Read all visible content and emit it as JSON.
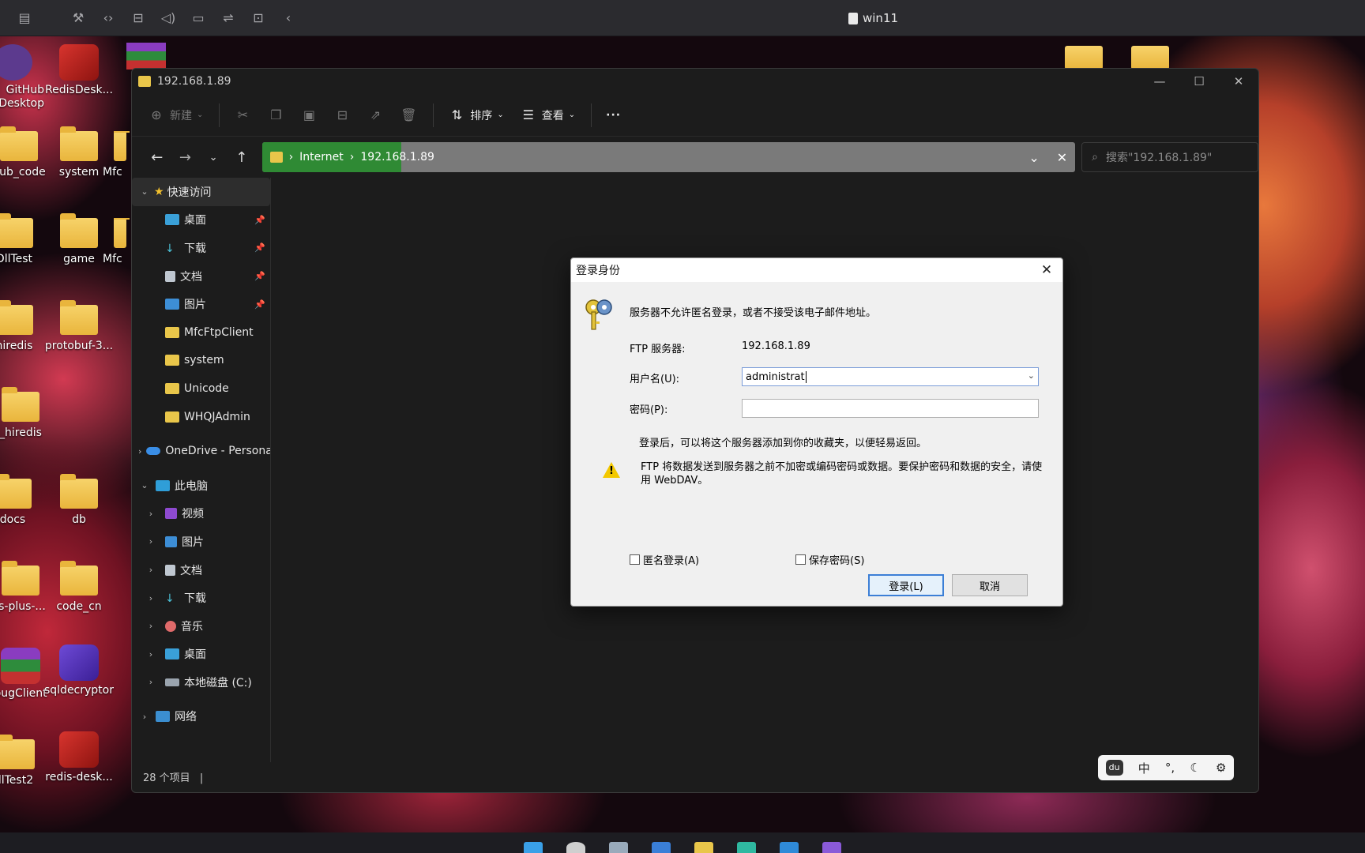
{
  "vm": {
    "title": "win11"
  },
  "desktop_icons": [
    {
      "label": "GitHub\nDesktop",
      "kind": "github"
    },
    {
      "label": "RedisDesk...",
      "kind": "redis"
    },
    {
      "label": "hub_code",
      "kind": "folder"
    },
    {
      "label": "system",
      "kind": "folder"
    },
    {
      "label": "Mfc",
      "kind": "folder"
    },
    {
      "label": "DllTest",
      "kind": "folder"
    },
    {
      "label": "game",
      "kind": "folder"
    },
    {
      "label": "Mfc",
      "kind": "folder"
    },
    {
      "label": "hiredis",
      "kind": "folder"
    },
    {
      "label": "protobuf-3...",
      "kind": "folder"
    },
    {
      "label": "_hiredis",
      "kind": "folder"
    },
    {
      "label": "docs",
      "kind": "folder"
    },
    {
      "label": "db",
      "kind": "folder"
    },
    {
      "label": "is-plus-...",
      "kind": "folder"
    },
    {
      "label": "code_cn",
      "kind": "folder"
    },
    {
      "label": "bugClient",
      "kind": "winrar"
    },
    {
      "label": "sqldecryptor",
      "kind": "sqldec"
    },
    {
      "label": "llTest2",
      "kind": "folder"
    },
    {
      "label": "redis-desk...",
      "kind": "redis"
    }
  ],
  "explorer": {
    "title": "192.168.1.89",
    "toolbar": {
      "new_label": "新建",
      "sort_label": "排序",
      "view_label": "查看",
      "more_label": "···"
    },
    "address": {
      "crumbs": [
        "Internet",
        "192.168.1.89"
      ],
      "search_placeholder": "搜索\"192.168.1.89\""
    },
    "sidebar": {
      "quick_access": "快速访问",
      "quick_items": [
        "桌面",
        "下载",
        "文档",
        "图片",
        "MfcFtpClient",
        "system",
        "Unicode",
        "WHQJAdmin"
      ],
      "onedrive": "OneDrive - Personal",
      "this_pc": "此电脑",
      "pc_items": [
        "视频",
        "图片",
        "文档",
        "下载",
        "音乐",
        "桌面",
        "本地磁盘 (C:)"
      ],
      "network": "网络"
    },
    "status": "28 个项目"
  },
  "dialog": {
    "title": "登录身份",
    "message": "服务器不允许匿名登录，或者不接受该电子邮件地址。",
    "ftp_server_label": "FTP 服务器:",
    "ftp_server_value": "192.168.1.89",
    "username_label": "用户名(U):",
    "username_value": "administrat",
    "password_label": "密码(P):",
    "hint": "登录后，可以将这个服务器添加到你的收藏夹，以便轻易返回。",
    "warning": "FTP 将数据发送到服务器之前不加密或编码密码或数据。要保护密码和数据的安全，请使用 WebDAV。",
    "anonymous_label": "匿名登录(A)",
    "save_password_label": "保存密码(S)",
    "login_button": "登录(L)",
    "cancel_button": "取消"
  },
  "ime": {
    "lang": "中",
    "punct": "°,"
  }
}
